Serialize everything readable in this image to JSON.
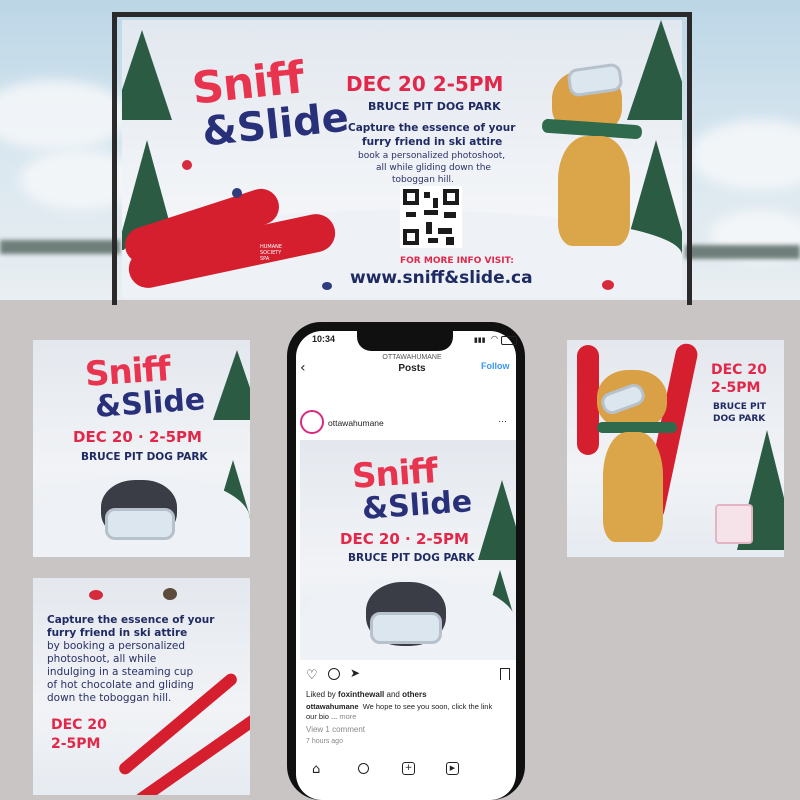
{
  "banner": {
    "title_line1": "Sniff",
    "title_line2": "&Slide",
    "date": "DEC 20 2-5PM",
    "venue": "BRUCE PIT DOG PARK",
    "tagline_line1": "Capture the essence of your",
    "tagline_line2": "furry friend in ski attire",
    "body_line1": "book a personalized photoshoot,",
    "body_line2": "all while gliding down the",
    "body_line3": "toboggan hill.",
    "info_label": "FOR MORE INFO VISIT:",
    "url": "www.sniff&slide.ca"
  },
  "sponsor": {
    "line1": "HUMANE",
    "line2": "SOCIETY",
    "line3": "SPA"
  },
  "card_left_top": {
    "title_line1": "Sniff",
    "title_line2": "&Slide",
    "date": "DEC 20 · 2-5PM",
    "venue": "BRUCE PIT DOG PARK"
  },
  "card_left_bottom": {
    "line1": "Capture the essence of your",
    "line2": "furry friend in ski attire",
    "line3": "by booking a personalized",
    "line4": "photoshoot, all while",
    "line5": "indulging in a steaming cup",
    "line6": "of hot chocolate and gliding",
    "line7": "down the toboggan hill.",
    "date_line1": "DEC 20",
    "date_line2": "2-5PM"
  },
  "card_right": {
    "date_line1": "DEC 20",
    "date_line2": "2-5PM",
    "venue_line1": "BRUCE PIT",
    "venue_line2": "DOG PARK"
  },
  "phone": {
    "time": "10:34",
    "header_account": "OTTAWAHUMANE",
    "header_title": "Posts",
    "follow": "Follow",
    "username": "ottawahumane",
    "more": "···",
    "post": {
      "title_line1": "Sniff",
      "title_line2": "&Slide",
      "date": "DEC 20 · 2-5PM",
      "venue": "BRUCE PIT DOG PARK"
    },
    "liked_prefix": "Liked by ",
    "liked_user": "foxinthewall",
    "liked_mid": " and ",
    "liked_others": "others",
    "caption_user": "ottawahumane",
    "caption_text": "We hope to see you soon, click the link",
    "caption_text2": "our bio ...",
    "caption_more": "more",
    "comments": "View 1 comment",
    "time_ago": "7 hours ago"
  },
  "icons": [
    "home-icon",
    "search-icon",
    "add-post-icon",
    "reels-icon",
    "heart-icon",
    "comment-icon",
    "share-icon",
    "bookmark-icon",
    "back-arrow-icon",
    "wifi-icon",
    "battery-icon",
    "signal-icon"
  ],
  "colors": {
    "red": "#e8344f",
    "navy": "#29307a",
    "ski_red": "#d51e2e",
    "instagram_blue": "#3897f0"
  }
}
